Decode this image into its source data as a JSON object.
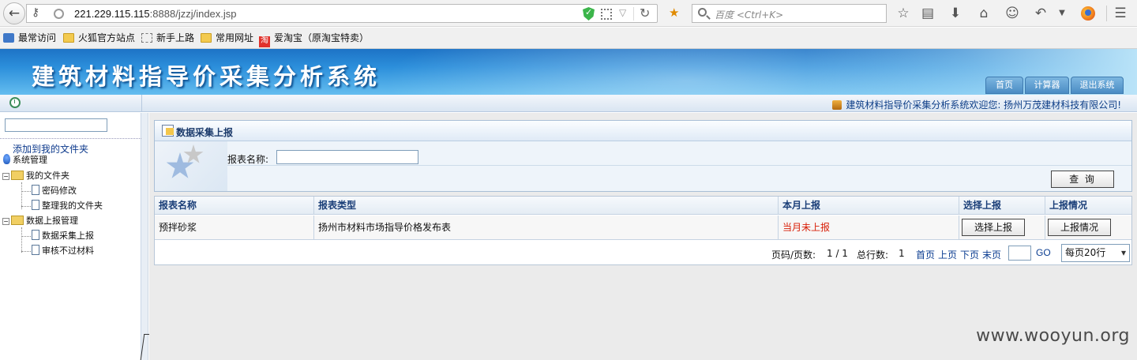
{
  "browser": {
    "url_host": "221.229.115.115",
    "url_rest": ":8888/jzzj/index.jsp",
    "search_placeholder": "百度 <Ctrl+K>",
    "bookmarks": [
      "最常访问",
      "火狐官方站点",
      "新手上路",
      "常用网址",
      "爱淘宝（原淘宝特卖）"
    ],
    "taobao_badge": "淘"
  },
  "header": {
    "title": "建筑材料指导价采集分析系统",
    "tabs": [
      "首页",
      "计算器",
      "退出系统"
    ]
  },
  "welcome": {
    "text": "建筑材料指导价采集分析系统欢迎您: 扬州万茂建材科技有限公司!"
  },
  "sidebar": {
    "fav_link": "添加到我的文件夹",
    "tree": [
      {
        "label": "系统管理"
      },
      {
        "label": "我的文件夹"
      },
      {
        "label": "密码修改"
      },
      {
        "label": "整理我的文件夹"
      },
      {
        "label": "数据上报管理"
      },
      {
        "label": "数据采集上报"
      },
      {
        "label": "审核不过材料"
      }
    ]
  },
  "panel": {
    "title": "数据采集上报",
    "field_label": "报表名称:",
    "query_button": "查 询"
  },
  "grid": {
    "headers": [
      "报表名称",
      "报表类型",
      "本月上报",
      "选择上报",
      "上报情况"
    ],
    "rows": [
      {
        "name": "预拌砂浆",
        "type": "扬州市材料市场指导价格发布表",
        "status": "当月未上报",
        "select_btn": "选择上报",
        "status_btn": "上报情况"
      }
    ]
  },
  "pager": {
    "page_label": "页码/页数:",
    "page_value": "1 / 1",
    "total_label": "总行数:",
    "total_value": "1",
    "first": "首页",
    "prev": "上页",
    "next": "下页",
    "last": "末页",
    "go": "GO",
    "per_page": "每页20行"
  },
  "watermark": "www.wooyun.org",
  "colors": {
    "header_blue": "#2c8fdb",
    "status_red": "#d81e06",
    "link_blue": "#0b3d91"
  }
}
